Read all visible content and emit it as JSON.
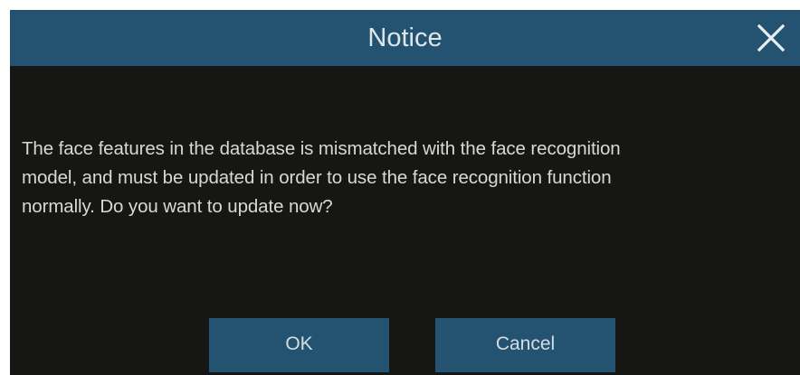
{
  "dialog": {
    "title": "Notice",
    "close_icon": "close-icon",
    "message": "The face features in the database is mismatched with the face recognition\nmodel, and must be updated in order to use the face recognition function\nnormally. Do you want to update now?",
    "ok_label": "OK",
    "cancel_label": "Cancel"
  },
  "colors": {
    "titlebar": "#245371",
    "body": "#161615",
    "button": "#245371",
    "text": "#d8d8d5"
  }
}
